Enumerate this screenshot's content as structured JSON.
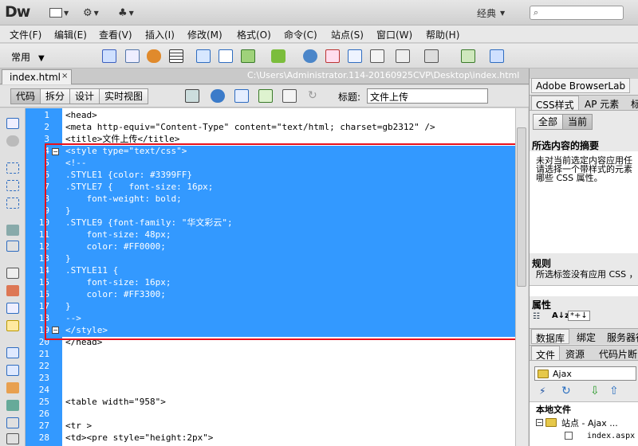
{
  "app": {
    "logo": "Dw",
    "workspace": "经典",
    "search_placeholder": ""
  },
  "menu": [
    "文件(F)",
    "编辑(E)",
    "查看(V)",
    "插入(I)",
    "修改(M)",
    "格式(O)",
    "命令(C)",
    "站点(S)",
    "窗口(W)",
    "帮助(H)"
  ],
  "insertbar": {
    "category": "常用"
  },
  "document": {
    "tab": "index.html",
    "path": "C:\\Users\\Administrator.114-20160925CVP\\Desktop\\index.html"
  },
  "view_buttons": [
    "代码",
    "拆分",
    "设计",
    "实时视图"
  ],
  "title_field": {
    "label": "标题:",
    "value": "文件上传"
  },
  "code": {
    "line_numbers": [
      "1",
      "2",
      "3",
      "4",
      "5",
      "6",
      "7",
      "8",
      "9",
      "10",
      "11",
      "12",
      "13",
      "14",
      "15",
      "16",
      "17",
      "18",
      "19",
      "20",
      "21",
      "22",
      "23",
      "24",
      "25",
      "26",
      "27",
      "28"
    ],
    "lines": [
      "<head>",
      "<meta http-equiv=\"Content-Type\" content=\"text/html; charset=gb2312\" />",
      "<title>文件上传</title>",
      "<style type=\"text/css\">",
      "<!--",
      ".STYLE1 {color: #3399FF}",
      ".STYLE7 {   font-size: 16px;",
      "    font-weight: bold;",
      "}",
      ".STYLE9 {font-family: \"华文彩云\";",
      "    font-size: 48px;",
      "    color: #FF0000;",
      "}",
      ".STYLE11 {",
      "    font-size: 16px;",
      "    color: #FF3300;",
      "}",
      "-->",
      "</style>",
      "</head>",
      "",
      "",
      "",
      "",
      "<table width=\"958\">",
      "",
      "<tr >",
      "<td><pre style=\"height:2px\">"
    ]
  },
  "panel": {
    "top_tab": "Adobe BrowserLab",
    "tabs": [
      "CSS样式",
      "AP 元素",
      "标"
    ],
    "mode_buttons": [
      "全部",
      "当前"
    ],
    "summary_title": "所选内容的摘要",
    "summary_lines": [
      "未对当前选定内容应用任",
      "请选择一个带样式的元素",
      "哪些 CSS 属性。"
    ],
    "rules_title": "规则",
    "rules_text": "所选标签没有应用 CSS ，",
    "props_title": "属性",
    "files_tabs_1": [
      "数据库",
      "绑定",
      "服务器行"
    ],
    "files_tabs_2": [
      "文件",
      "资源",
      "代码片断"
    ],
    "site_select": "Ajax",
    "local_files": "本地文件",
    "tree": [
      "站点 - Ajax ...",
      "index.aspx"
    ]
  },
  "colors": {
    "selection": "#3399FF",
    "highlight_box": "#E8101A"
  }
}
